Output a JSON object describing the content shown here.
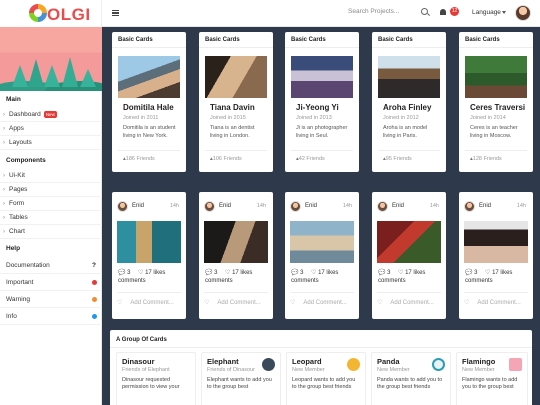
{
  "header": {
    "logo_text": "OLGI",
    "search_placeholder": "Search Projects...",
    "notification_count": "12",
    "language_label": "Language"
  },
  "sidebar": {
    "section_main": "Main",
    "main_items": [
      {
        "label": "Dashboard",
        "badge": "New"
      },
      {
        "label": "Apps"
      },
      {
        "label": "Layouts"
      }
    ],
    "section_components": "Components",
    "component_items": [
      {
        "label": "Ui-Kit"
      },
      {
        "label": "Pages"
      },
      {
        "label": "Form"
      },
      {
        "label": "Tables"
      },
      {
        "label": "Chart"
      }
    ],
    "section_help": "Help",
    "help_items": [
      {
        "label": "Documentation",
        "marker": "?"
      },
      {
        "label": "Important",
        "dot_color": "#e53935"
      },
      {
        "label": "Warning",
        "dot_color": "#f08c2a"
      },
      {
        "label": "Info",
        "dot_color": "#2196f3"
      }
    ]
  },
  "profile_cards": [
    {
      "header": "Basic Cards",
      "name": "Domitila Hale",
      "joined": "Joined in 2011",
      "about": "Domitila is an student living in New York.",
      "friends": "186 Friends"
    },
    {
      "header": "Basic Cards",
      "name": "Tiana Davin",
      "joined": "Joined in 2015",
      "about": "Tiana is an dentist living in London.",
      "friends": "106 Friends"
    },
    {
      "header": "Basic Cards",
      "name": "Ji-Yeong Yi",
      "joined": "Joined in 2013",
      "about": "Ji is an photographer living in Seul.",
      "friends": "42 Friends"
    },
    {
      "header": "Basic Cards",
      "name": "Aroha Finley",
      "joined": "Joined in 2012",
      "about": "Aroha is an model living in Paris.",
      "friends": "95 Friends"
    },
    {
      "header": "Basic Cards",
      "name": "Ceres Traversi",
      "joined": "Joined in 2014",
      "about": "Ceres is an teacher living in Moscow.",
      "friends": "128 Friends"
    }
  ],
  "post_cards": [
    {
      "author": "Enid",
      "time": "14h",
      "comments_count": "3",
      "likes": "17 likes",
      "comments_label": "comments",
      "add_comment": "Add Comment..."
    },
    {
      "author": "Enid",
      "time": "14h",
      "comments_count": "3",
      "likes": "17 likes",
      "comments_label": "comments",
      "add_comment": "Add Comment..."
    },
    {
      "author": "Enid",
      "time": "14h",
      "comments_count": "3",
      "likes": "17 likes",
      "comments_label": "comments",
      "add_comment": "Add Comment..."
    },
    {
      "author": "Enid",
      "time": "14h",
      "comments_count": "3",
      "likes": "17 likes",
      "comments_label": "comments",
      "add_comment": "Add Comment..."
    },
    {
      "author": "Enid",
      "time": "14h",
      "comments_count": "3",
      "likes": "17 likes",
      "comments_label": "comments",
      "add_comment": "Add Comment..."
    }
  ],
  "group": {
    "title": "A Group Of Cards",
    "items": [
      {
        "name": "Dinasour",
        "sub": "Friends of Elephant",
        "desc": "Dinasour requested permission to view your"
      },
      {
        "name": "Elephant",
        "sub": "Friends of Dinasour",
        "desc": "Elephant wants to add you to the group best"
      },
      {
        "name": "Leopard",
        "sub": "New Member",
        "desc": "Leopard wants to add you to the group best friends"
      },
      {
        "name": "Panda",
        "sub": "New Member",
        "desc": "Panda wants to add you to the group best friends"
      },
      {
        "name": "Flamingo",
        "sub": "New Member",
        "desc": "Flamingo wants to add you to the group best"
      }
    ]
  },
  "icons": {
    "menu": "hamburger-icon",
    "search": "search-icon",
    "notifications": "bell-icon",
    "comment": "comment-icon",
    "like": "heart-icon",
    "friends": "user-icon"
  },
  "colors": {
    "brand": "#e94c4c",
    "content_background": "#2e3a4c",
    "badge_red": "#e53935"
  }
}
